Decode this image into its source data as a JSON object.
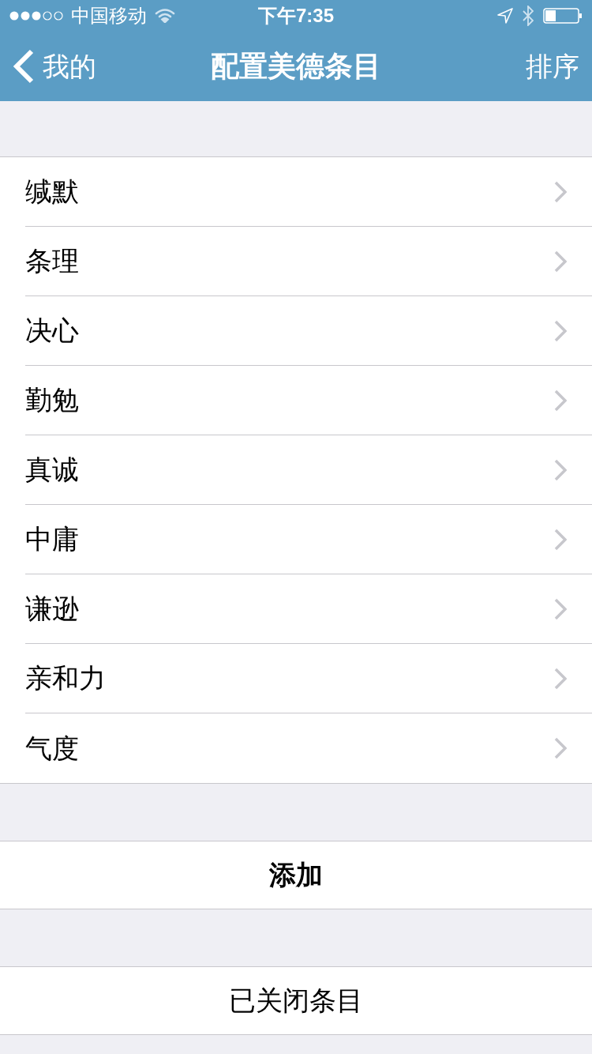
{
  "status_bar": {
    "carrier": "中国移动",
    "time": "下午7:35"
  },
  "nav_bar": {
    "back": "我的",
    "title": "配置美德条目",
    "action": "排序"
  },
  "items": [
    {
      "label": "缄默"
    },
    {
      "label": "条理"
    },
    {
      "label": "决心"
    },
    {
      "label": "勤勉"
    },
    {
      "label": "真诚"
    },
    {
      "label": "中庸"
    },
    {
      "label": "谦逊"
    },
    {
      "label": "亲和力"
    },
    {
      "label": "气度"
    }
  ],
  "add_button": "添加",
  "closed_items_button": "已关闭条目"
}
